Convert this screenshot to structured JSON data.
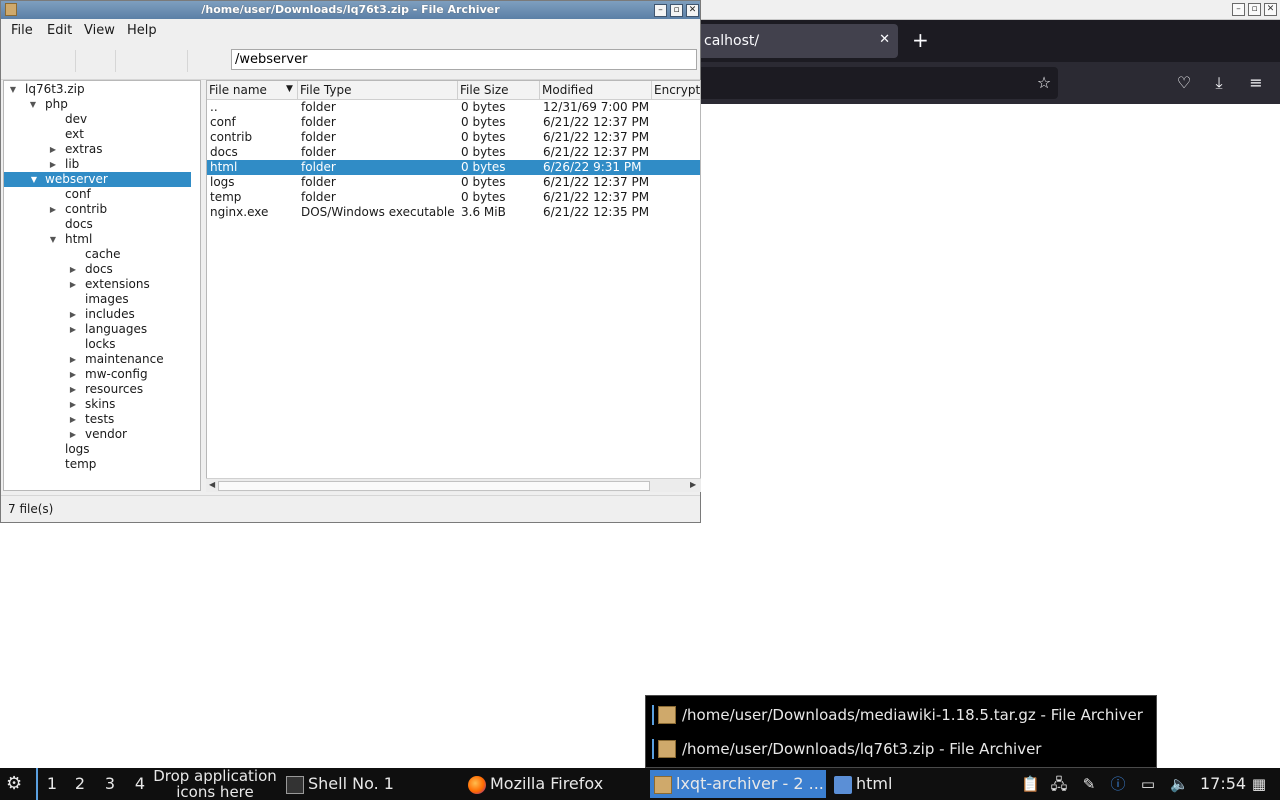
{
  "firefox": {
    "tab_title": "calhost/",
    "tab_close": "✕",
    "new_tab": "+",
    "titlebar_buttons": [
      "▫",
      "▫",
      "✕"
    ]
  },
  "archiver": {
    "title": "/home/user/Downloads/lq76t3.zip - File Archiver",
    "menu": {
      "file": "File",
      "edit": "Edit",
      "view": "View",
      "help": "Help"
    },
    "path": "/webserver",
    "tree": [
      {
        "label": "lq76t3.zip",
        "arrow": "▼"
      },
      {
        "label": "php",
        "arrow": "▼"
      },
      {
        "label": "dev",
        "arrow": ""
      },
      {
        "label": "ext",
        "arrow": ""
      },
      {
        "label": "extras",
        "arrow": "▶"
      },
      {
        "label": "lib",
        "arrow": "▶"
      },
      {
        "label": "webserver",
        "arrow": "▼"
      },
      {
        "label": "conf",
        "arrow": ""
      },
      {
        "label": "contrib",
        "arrow": "▶"
      },
      {
        "label": "docs",
        "arrow": ""
      },
      {
        "label": "html",
        "arrow": "▼"
      },
      {
        "label": "cache",
        "arrow": ""
      },
      {
        "label": "docs",
        "arrow": "▶"
      },
      {
        "label": "extensions",
        "arrow": "▶"
      },
      {
        "label": "images",
        "arrow": ""
      },
      {
        "label": "includes",
        "arrow": "▶"
      },
      {
        "label": "languages",
        "arrow": "▶"
      },
      {
        "label": "locks",
        "arrow": ""
      },
      {
        "label": "maintenance",
        "arrow": "▶"
      },
      {
        "label": "mw-config",
        "arrow": "▶"
      },
      {
        "label": "resources",
        "arrow": "▶"
      },
      {
        "label": "skins",
        "arrow": "▶"
      },
      {
        "label": "tests",
        "arrow": "▶"
      },
      {
        "label": "vendor",
        "arrow": "▶"
      },
      {
        "label": "logs",
        "arrow": ""
      },
      {
        "label": "temp",
        "arrow": ""
      }
    ],
    "columns": [
      "File name",
      "File Type",
      "File Size",
      "Modified",
      "Encrypt"
    ],
    "files": [
      {
        "name": "..",
        "type": "folder",
        "size": "0 bytes",
        "modified": "12/31/69 7:00 PM"
      },
      {
        "name": "conf",
        "type": "folder",
        "size": "0 bytes",
        "modified": "6/21/22 12:37 PM"
      },
      {
        "name": "contrib",
        "type": "folder",
        "size": "0 bytes",
        "modified": "6/21/22 12:37 PM"
      },
      {
        "name": "docs",
        "type": "folder",
        "size": "0 bytes",
        "modified": "6/21/22 12:37 PM"
      },
      {
        "name": "html",
        "type": "folder",
        "size": "0 bytes",
        "modified": "6/26/22 9:31 PM"
      },
      {
        "name": "logs",
        "type": "folder",
        "size": "0 bytes",
        "modified": "6/21/22 12:37 PM"
      },
      {
        "name": "temp",
        "type": "folder",
        "size": "0 bytes",
        "modified": "6/21/22 12:37 PM"
      },
      {
        "name": "nginx.exe",
        "type": "DOS/Windows executable",
        "size": "3.6 MiB",
        "modified": "6/21/22 12:35 PM"
      }
    ],
    "status": "7 file(s)"
  },
  "popup": {
    "items": [
      "/home/user/Downloads/mediawiki-1.18.5.tar.gz - File Archiver",
      "/home/user/Downloads/lq76t3.zip - File Archiver"
    ]
  },
  "taskbar": {
    "desktops": [
      "1",
      "2",
      "3",
      "4"
    ],
    "drop_hint_line1": "Drop application",
    "drop_hint_line2": "icons here",
    "shell": "Shell No. 1",
    "firefox": "Mozilla Firefox",
    "archiver": "lxqt-archiver - 2 ...",
    "files": "html",
    "clock": "17:54"
  }
}
